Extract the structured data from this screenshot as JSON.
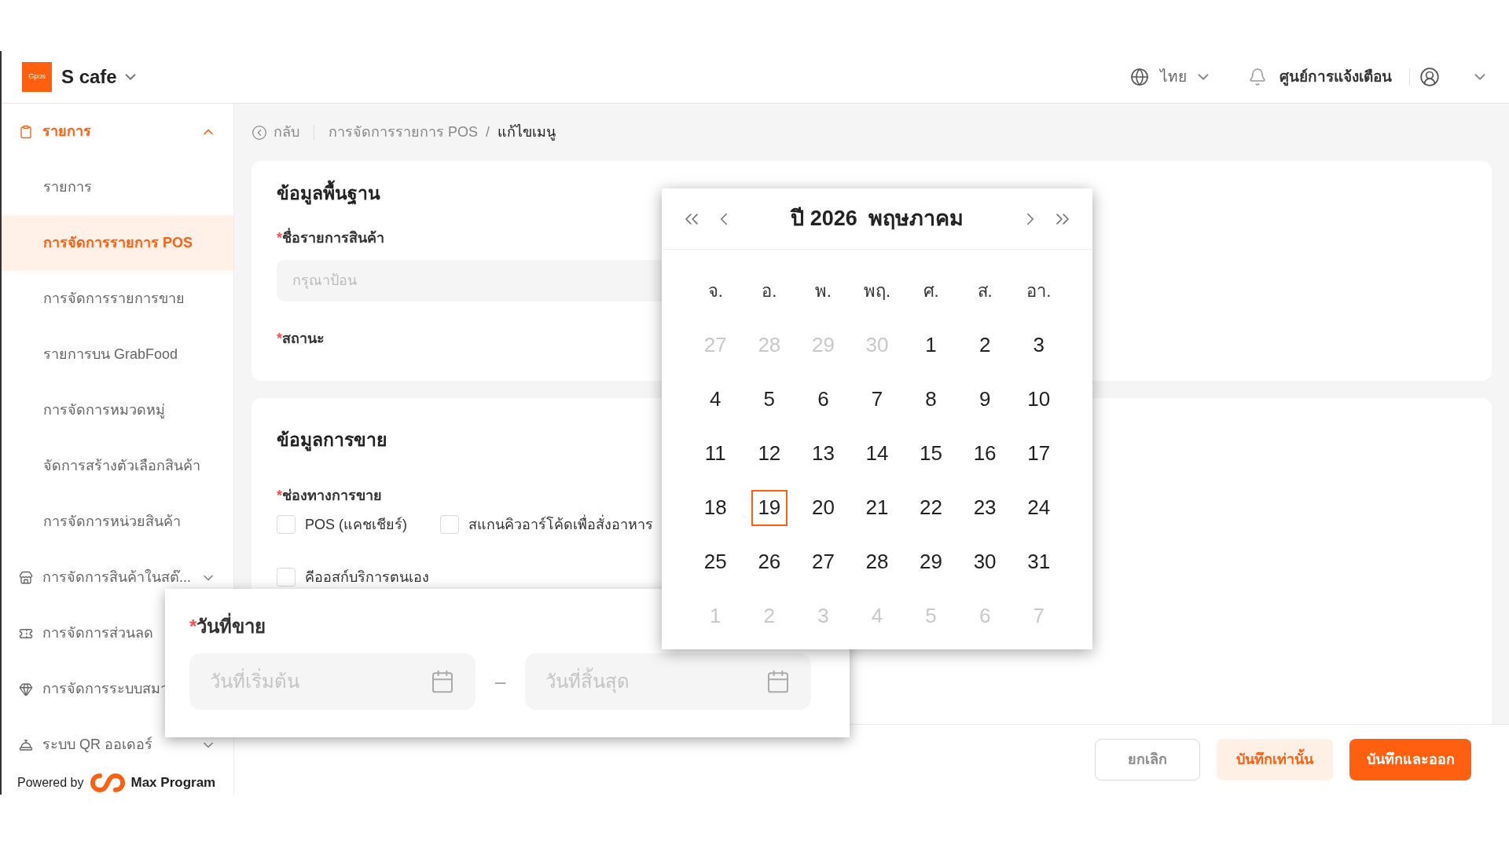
{
  "header": {
    "logo_text": "Gpos",
    "store": "S cafe",
    "language": "ไทย",
    "notifications": "ศูนย์การแจ้งเตือน"
  },
  "sidebar": {
    "items": [
      {
        "kind": "group",
        "label": "รายการ",
        "expanded": true,
        "children": [
          {
            "label": "รายการ",
            "selected": false
          },
          {
            "label": "การจัดการรายการ POS",
            "selected": true
          },
          {
            "label": "การจัดการรายการขาย",
            "selected": false
          },
          {
            "label": "รายการบน GrabFood",
            "selected": false
          },
          {
            "label": "การจัดการหมวดหมู่",
            "selected": false
          },
          {
            "label": "จัดการสร้างตัวเลือกสินค้า",
            "selected": false
          },
          {
            "label": "การจัดการหน่วยสินค้า",
            "selected": false
          }
        ]
      },
      {
        "kind": "group",
        "label": "การจัดการสินค้าในสต๊...",
        "expanded": false
      },
      {
        "kind": "group",
        "label": "การจัดการส่วนลด"
      },
      {
        "kind": "group",
        "label": "การจัดการระบบสมา"
      },
      {
        "kind": "group",
        "label": "ระบบ QR ออเดอร์",
        "expanded": false
      }
    ],
    "powered_by": "Powered by",
    "brand": "Max Program"
  },
  "breadcrumb": {
    "back": "กลับ",
    "items": [
      "การจัดการรายการ POS",
      "แก้ไขเมนู"
    ],
    "separator": "/"
  },
  "basic_card": {
    "title": "ข้อมูลพื้นฐาน",
    "name_label": {
      "mark": "*",
      "text": "ชื่อรายการสินค้า"
    },
    "name_placeholder": "กรุณาป้อน",
    "status_label": {
      "mark": "*",
      "text": "สถานะ"
    }
  },
  "sales_card": {
    "title": "ข้อมูลการขาย",
    "channel_label": {
      "mark": "*",
      "text": "ช่องทางการขาย"
    },
    "channels": [
      {
        "label": "POS (แคชเชียร์)",
        "checked": false
      },
      {
        "label": "สแกนคิวอาร์โค้ดเพื่อสั่งอาหาร",
        "checked": false
      },
      {
        "label": "คีออสก์บริการตนเอง",
        "checked": false
      }
    ]
  },
  "date_popup": {
    "label": {
      "mark": "*",
      "text": "วันที่ขาย"
    },
    "start_placeholder": "วันที่เริ่มต้น",
    "separator": "–",
    "end_placeholder": "วันที่สิ้นสุด"
  },
  "calendar": {
    "year": "ปี 2026",
    "month": "พฤษภาคม",
    "weekdays": [
      "จ.",
      "อ.",
      "พ.",
      "พฤ.",
      "ศ.",
      "ส.",
      "อา."
    ],
    "days": [
      {
        "day": "27",
        "current_month": false,
        "today": false
      },
      {
        "day": "28",
        "current_month": false,
        "today": false
      },
      {
        "day": "29",
        "current_month": false,
        "today": false
      },
      {
        "day": "30",
        "current_month": false,
        "today": false
      },
      {
        "day": "1",
        "current_month": true,
        "today": false
      },
      {
        "day": "2",
        "current_month": true,
        "today": false
      },
      {
        "day": "3",
        "current_month": true,
        "today": false
      },
      {
        "day": "4",
        "current_month": true,
        "today": false
      },
      {
        "day": "5",
        "current_month": true,
        "today": false
      },
      {
        "day": "6",
        "current_month": true,
        "today": false
      },
      {
        "day": "7",
        "current_month": true,
        "today": false
      },
      {
        "day": "8",
        "current_month": true,
        "today": false
      },
      {
        "day": "9",
        "current_month": true,
        "today": false
      },
      {
        "day": "10",
        "current_month": true,
        "today": false
      },
      {
        "day": "11",
        "current_month": true,
        "today": false
      },
      {
        "day": "12",
        "current_month": true,
        "today": false
      },
      {
        "day": "13",
        "current_month": true,
        "today": false
      },
      {
        "day": "14",
        "current_month": true,
        "today": false
      },
      {
        "day": "15",
        "current_month": true,
        "today": false
      },
      {
        "day": "16",
        "current_month": true,
        "today": false
      },
      {
        "day": "17",
        "current_month": true,
        "today": false
      },
      {
        "day": "18",
        "current_month": true,
        "today": false
      },
      {
        "day": "19",
        "current_month": true,
        "today": true
      },
      {
        "day": "20",
        "current_month": true,
        "today": false
      },
      {
        "day": "21",
        "current_month": true,
        "today": false
      },
      {
        "day": "22",
        "current_month": true,
        "today": false
      },
      {
        "day": "23",
        "current_month": true,
        "today": false
      },
      {
        "day": "24",
        "current_month": true,
        "today": false
      },
      {
        "day": "25",
        "current_month": true,
        "today": false
      },
      {
        "day": "26",
        "current_month": true,
        "today": false
      },
      {
        "day": "27",
        "current_month": true,
        "today": false
      },
      {
        "day": "28",
        "current_month": true,
        "today": false
      },
      {
        "day": "29",
        "current_month": true,
        "today": false
      },
      {
        "day": "30",
        "current_month": true,
        "today": false
      },
      {
        "day": "31",
        "current_month": true,
        "today": false
      },
      {
        "day": "1",
        "current_month": false,
        "today": false
      },
      {
        "day": "2",
        "current_month": false,
        "today": false
      },
      {
        "day": "3",
        "current_month": false,
        "today": false
      },
      {
        "day": "4",
        "current_month": false,
        "today": false
      },
      {
        "day": "5",
        "current_month": false,
        "today": false
      },
      {
        "day": "6",
        "current_month": false,
        "today": false
      },
      {
        "day": "7",
        "current_month": false,
        "today": false
      }
    ]
  },
  "footer": {
    "buttons": [
      {
        "label": "ยกเลิก",
        "kind": "outline"
      },
      {
        "label": "บันทึกเท่านั้น",
        "kind": "light"
      },
      {
        "label": "บันทึกและออก",
        "kind": "primary"
      }
    ]
  }
}
